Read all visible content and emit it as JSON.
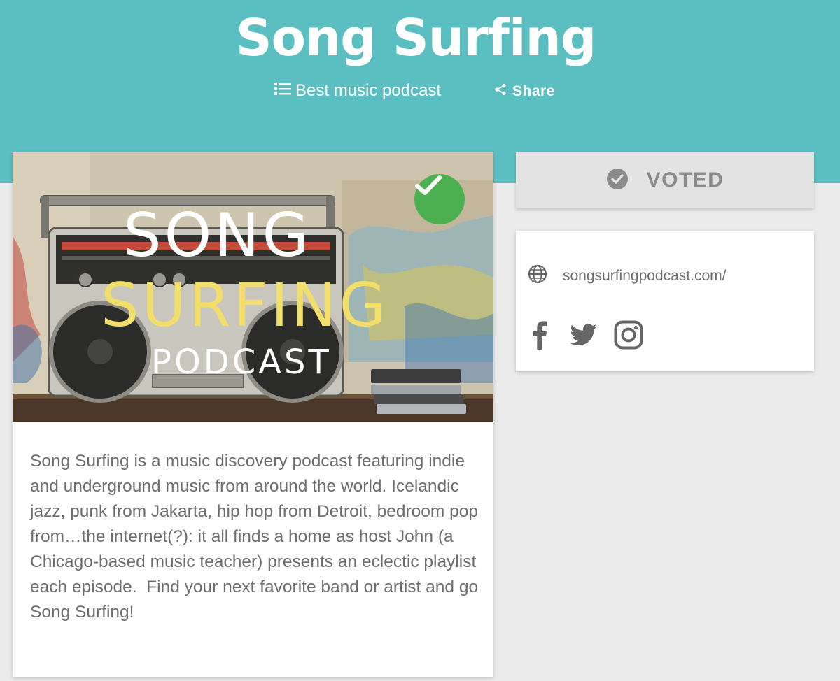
{
  "header": {
    "title": "Song Surfing",
    "category": "Best music podcast",
    "share_label": "Share"
  },
  "cover": {
    "line1": "SONG",
    "line2": "SURFING",
    "line3": "PODCAST"
  },
  "description": "Song Surfing is a music discovery podcast featuring indie and underground music from around the world. Icelandic jazz, punk from Jakarta, hip hop from Detroit, bedroom pop from…the internet(?): it all finds a home as host John (a Chicago-based music teacher) presents an eclectic playlist each episode.  Find your next favorite band or artist and go Song Surfing!",
  "vote": {
    "label": "VOTED"
  },
  "links": {
    "website": "songsurfingpodcast.com/",
    "social": [
      "facebook-icon",
      "twitter-icon",
      "instagram-icon"
    ]
  },
  "colors": {
    "hero": "#5bbfc2",
    "voted_badge": "#4caf50",
    "cover_yellow": "#f2de6a"
  }
}
